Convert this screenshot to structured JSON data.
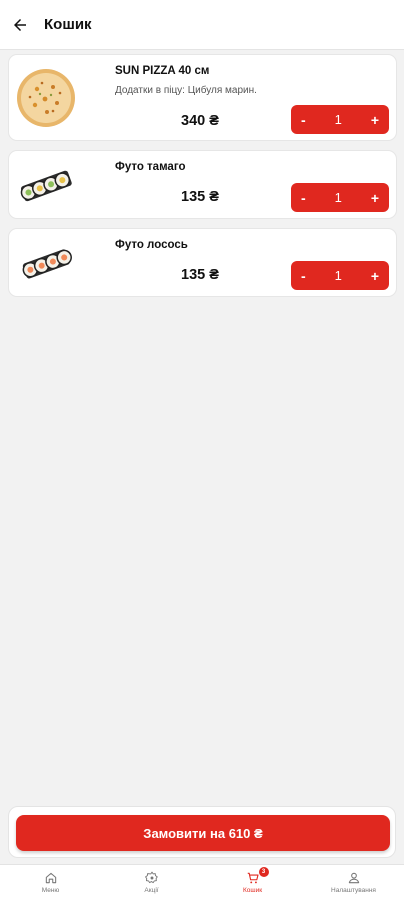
{
  "header": {
    "title": "Кошик"
  },
  "cart": {
    "items": [
      {
        "name": "SUN PIZZA 40 см",
        "addons": "Додатки в піцу: Цибуля марин.",
        "price": "340 ₴",
        "quantity": "1",
        "minus": "-",
        "plus": "+",
        "image_icon": "pizza-icon"
      },
      {
        "name": "Футо тамаго",
        "price": "135 ₴",
        "quantity": "1",
        "minus": "-",
        "plus": "+",
        "image_icon": "sushi-roll-icon"
      },
      {
        "name": "Футо лосось",
        "price": "135 ₴",
        "quantity": "1",
        "minus": "-",
        "plus": "+",
        "image_icon": "sushi-roll-icon"
      }
    ]
  },
  "order": {
    "button_label": "Замовити на 610 ₴"
  },
  "nav": {
    "items": [
      {
        "label": "Меню",
        "icon": "home-icon"
      },
      {
        "label": "Акції",
        "icon": "promo-icon"
      },
      {
        "label": "Кошик",
        "icon": "cart-icon",
        "badge": "3"
      },
      {
        "label": "Налаштування",
        "icon": "user-icon"
      }
    ]
  },
  "colors": {
    "accent": "#e0281f",
    "background": "#f2f2f2",
    "card": "#ffffff"
  }
}
